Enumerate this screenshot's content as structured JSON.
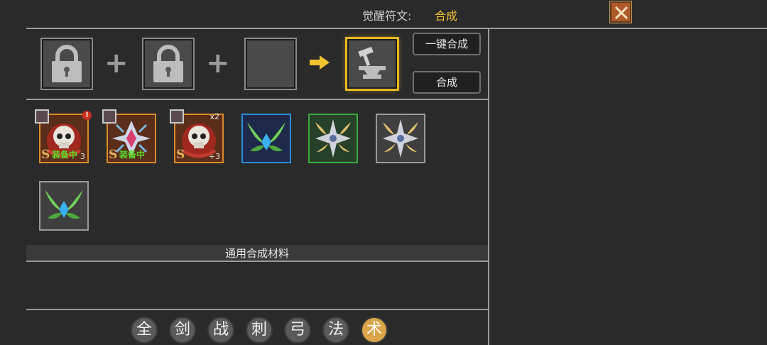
{
  "header": {
    "label": "觉醒符文:",
    "value": "合成",
    "close_icon": "close-x-icon"
  },
  "colors": {
    "accent": "#f2c12e",
    "tab_active": "#d9a548",
    "equip_text": "#5cdc2a"
  },
  "craft": {
    "slot1_icon": "lock-icon",
    "slot2_icon": "lock-icon",
    "slot3_icon": "empty-slot",
    "result_icon": "anvil-icon",
    "plus_1": "+",
    "plus_2": "+",
    "one_click_label": "一键合成",
    "craft_label": "合成"
  },
  "items": [
    {
      "icon": "red-skull-rune",
      "grade": "S",
      "status": "装备中",
      "level": "3",
      "alert": "!",
      "frame_color": "#d98a2a"
    },
    {
      "icon": "pink-crystal-rune",
      "grade": "S",
      "status": "装备中",
      "frame_color": "#d98a2a"
    },
    {
      "icon": "red-skull-rune",
      "grade": "S",
      "count": "x2",
      "enhance": "+3",
      "frame_color": "#d98a2a"
    },
    {
      "icon": "green-leaf-blue-gem-rune",
      "frame_color": "#2a8fd9"
    },
    {
      "icon": "gold-silver-star-rune",
      "frame_color": "#3aaa3a"
    },
    {
      "icon": "gold-silver-star-rune",
      "frame_color": "#9a9a9a"
    },
    {
      "icon": "green-leaf-blue-gem-rune",
      "frame_color": "#9a9a9a"
    }
  ],
  "section": {
    "title": "通用合成材料"
  },
  "tabs": [
    {
      "label": "全",
      "active": false
    },
    {
      "label": "剑",
      "active": false
    },
    {
      "label": "战",
      "active": false
    },
    {
      "label": "刺",
      "active": false
    },
    {
      "label": "弓",
      "active": false
    },
    {
      "label": "法",
      "active": false
    },
    {
      "label": "术",
      "active": true
    }
  ]
}
